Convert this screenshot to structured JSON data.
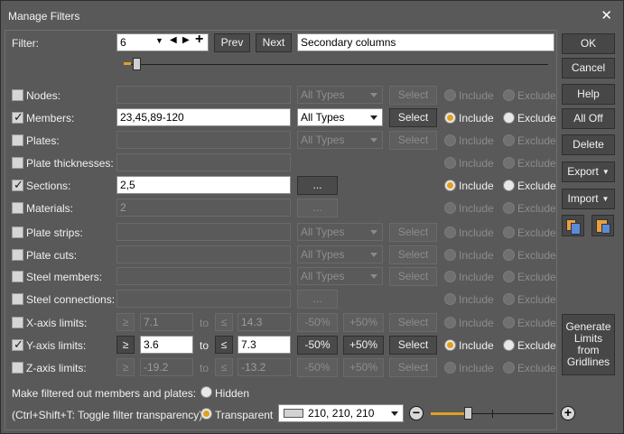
{
  "window": {
    "title": "Manage Filters"
  },
  "filter": {
    "label": "Filter:",
    "number": "6",
    "prev_label": "Prev",
    "next_label": "Next",
    "name": "Secondary columns",
    "slider_level": 0.03
  },
  "rows": [
    {
      "label": "Nodes:",
      "checked": false,
      "value": "",
      "type": "All Types",
      "select": "Select",
      "include": "Include",
      "exclude": "Exclude"
    },
    {
      "label": "Members:",
      "checked": true,
      "value": "23,45,89-120",
      "type": "All Types",
      "select": "Select",
      "include": "Include",
      "exclude": "Exclude"
    },
    {
      "label": "Plates:",
      "checked": false,
      "value": "",
      "type": "All Types",
      "select": "Select",
      "include": "Include",
      "exclude": "Exclude"
    },
    {
      "label": "Plate thicknesses:",
      "checked": false,
      "value": "",
      "include": "Include",
      "exclude": "Exclude"
    },
    {
      "label": "Sections:",
      "checked": true,
      "value": "2,5",
      "browse": "...",
      "include": "Include",
      "exclude": "Exclude"
    },
    {
      "label": "Materials:",
      "checked": false,
      "value": "2",
      "browse": "...",
      "include": "Include",
      "exclude": "Exclude"
    },
    {
      "label": "Plate strips:",
      "checked": false,
      "value": "",
      "type": "All Types",
      "select": "Select",
      "include": "Include",
      "exclude": "Exclude"
    },
    {
      "label": "Plate cuts:",
      "checked": false,
      "value": "",
      "type": "All Types",
      "select": "Select",
      "include": "Include",
      "exclude": "Exclude"
    },
    {
      "label": "Steel members:",
      "checked": false,
      "value": "",
      "type": "All Types",
      "select": "Select",
      "include": "Include",
      "exclude": "Exclude"
    },
    {
      "label": "Steel connections:",
      "checked": false,
      "value": "",
      "browse": "...",
      "include": "Include",
      "exclude": "Exclude"
    }
  ],
  "axes": [
    {
      "label": "X-axis limits:",
      "checked": false,
      "ge": "≥",
      "min": "7.1",
      "to": "to",
      "le": "≤",
      "max": "14.3",
      "minus": "-50%",
      "plus": "+50%",
      "select": "Select",
      "include": "Include",
      "exclude": "Exclude"
    },
    {
      "label": "Y-axis limits:",
      "checked": true,
      "ge": "≥",
      "min": "3.6",
      "to": "to",
      "le": "≤",
      "max": "7.3",
      "minus": "-50%",
      "plus": "+50%",
      "select": "Select",
      "include": "Include",
      "exclude": "Exclude"
    },
    {
      "label": "Z-axis limits:",
      "checked": false,
      "ge": "≥",
      "min": "-19.2",
      "to": "to",
      "le": "≤",
      "max": "-13.2",
      "minus": "-50%",
      "plus": "+50%",
      "select": "Select",
      "include": "Include",
      "exclude": "Exclude"
    }
  ],
  "bottom": {
    "make_filtered_label": "Make filtered out members and plates:",
    "hidden_label": "Hidden",
    "shortcut_label": "(Ctrl+Shift+T: Toggle filter transparency)",
    "transparent_label": "Transparent",
    "color_value": "210, 210, 210",
    "color_swatch": "#d2d2d2",
    "transparency_level": 0.3
  },
  "side": {
    "ok": "OK",
    "cancel": "Cancel",
    "help": "Help",
    "all_off": "All Off",
    "delete": "Delete",
    "export": "Export",
    "import": "Import",
    "generate_limits": [
      "Generate",
      "Limits",
      "from",
      "Gridlines"
    ]
  },
  "colors": {
    "accent": "#e0a020",
    "background": "#595959"
  }
}
